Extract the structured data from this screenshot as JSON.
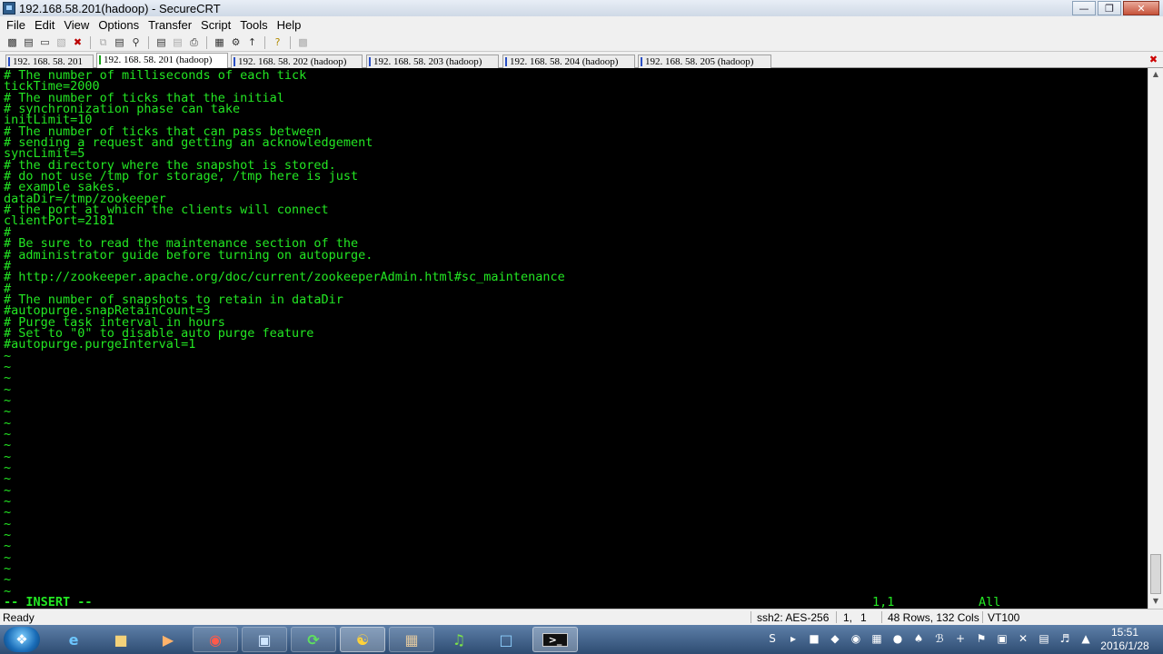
{
  "window": {
    "title": "192.168.58.201(hadoop) - SecureCRT"
  },
  "menu": [
    "File",
    "Edit",
    "View",
    "Options",
    "Transfer",
    "Script",
    "Tools",
    "Help"
  ],
  "toolbar_icons": [
    "connect-icon",
    "quick-connect-icon",
    "connect-tab-icon",
    "reconnect-icon",
    "disconnect-icon",
    "copy-icon",
    "paste-icon",
    "find-icon",
    "print-icon",
    "print-selection-icon",
    "print-icon-2",
    "session-options-icon",
    "global-options-icon",
    "keymap-icon",
    "help-icon",
    "sftp-icon"
  ],
  "tabs": [
    {
      "label": "192. 168. 58. 201",
      "active": false
    },
    {
      "label": "192. 168. 58. 201 (hadoop)",
      "active": true
    },
    {
      "label": "192. 168. 58. 202 (hadoop)",
      "active": false
    },
    {
      "label": "192. 168. 58. 203 (hadoop)",
      "active": false
    },
    {
      "label": "192. 168. 58. 204 (hadoop)",
      "active": false
    },
    {
      "label": "192. 168. 58. 205 (hadoop)",
      "active": false
    }
  ],
  "terminal": {
    "lines": [
      "# The number of milliseconds of each tick",
      "tickTime=2000",
      "# The number of ticks that the initial",
      "# synchronization phase can take",
      "initLimit=10",
      "# The number of ticks that can pass between",
      "# sending a request and getting an acknowledgement",
      "syncLimit=5",
      "# the directory where the snapshot is stored.",
      "# do not use /tmp for storage, /tmp here is just",
      "# example sakes.",
      "dataDir=/tmp/zookeeper",
      "# the port at which the clients will connect",
      "clientPort=2181",
      "#",
      "# Be sure to read the maintenance section of the",
      "# administrator guide before turning on autopurge.",
      "#",
      "# http://zookeeper.apache.org/doc/current/zookeeperAdmin.html#sc_maintenance",
      "#",
      "# The number of snapshots to retain in dataDir",
      "#autopurge.snapRetainCount=3",
      "# Purge task interval in hours",
      "# Set to \"0\" to disable auto purge feature",
      "#autopurge.purgeInterval=1",
      "~",
      "~",
      "~",
      "~",
      "~",
      "~",
      "~",
      "~",
      "~",
      "~",
      "~",
      "~",
      "~",
      "~",
      "~",
      "~",
      "~",
      "~",
      "~",
      "~",
      "~",
      "~"
    ],
    "mode": "-- INSERT --",
    "position": "1,1",
    "scroll": "All"
  },
  "status": {
    "state": "Ready",
    "cipher": "ssh2: AES-256",
    "row": "1,",
    "col": "1",
    "size": "48 Rows, 132 Cols",
    "emulation": "VT100"
  },
  "taskbar": {
    "apps": [
      "ie-icon",
      "explorer-icon",
      "media-player-icon",
      "chrome-icon",
      "vpn-icon",
      "download-icon",
      "tools-icon",
      "archive-icon",
      "music-icon",
      "virtualbox-icon",
      "securecrt-icon"
    ],
    "time": "15:51",
    "date": "2016/1/28"
  }
}
